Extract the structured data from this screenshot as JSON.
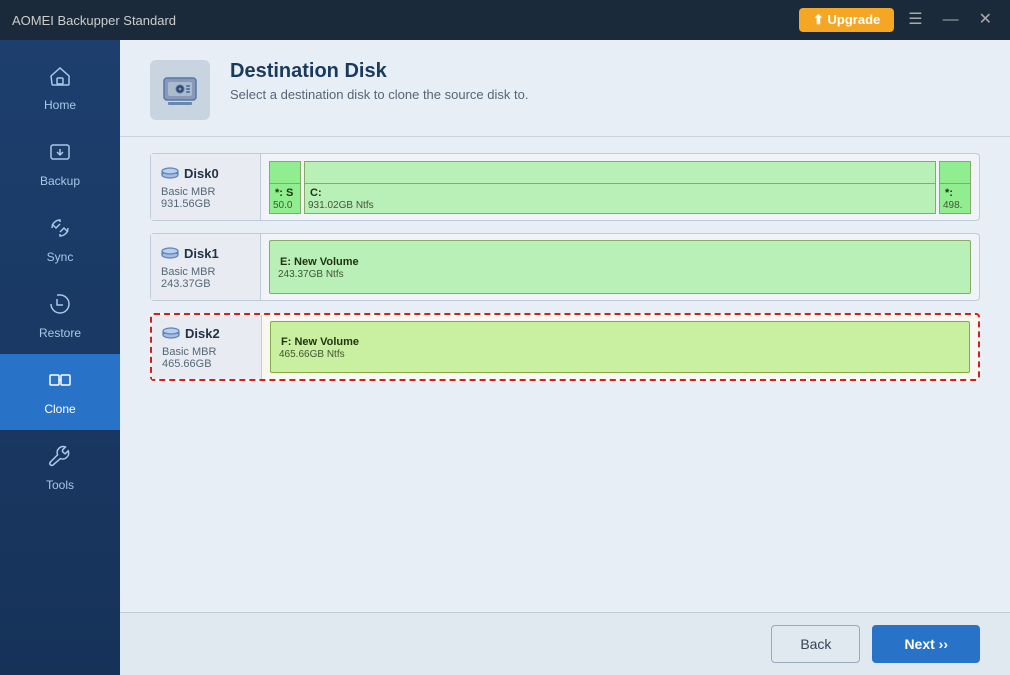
{
  "titlebar": {
    "title": "AOMEI Backupper Standard",
    "upgrade_label": "⬆ Upgrade",
    "menu_icon": "☰",
    "minimize_icon": "—",
    "close_icon": "✕"
  },
  "sidebar": {
    "items": [
      {
        "id": "home",
        "label": "Home",
        "icon": "🏠",
        "active": false
      },
      {
        "id": "backup",
        "label": "Backup",
        "icon": "📤",
        "active": false
      },
      {
        "id": "sync",
        "label": "Sync",
        "icon": "🔄",
        "active": false
      },
      {
        "id": "restore",
        "label": "Restore",
        "icon": "↩",
        "active": false
      },
      {
        "id": "clone",
        "label": "Clone",
        "icon": "🖧",
        "active": true
      },
      {
        "id": "tools",
        "label": "Tools",
        "icon": "🔧",
        "active": false
      }
    ]
  },
  "header": {
    "icon": "🖥",
    "title": "Destination Disk",
    "subtitle": "Select a destination disk to clone the source disk to."
  },
  "disks": [
    {
      "id": "disk0",
      "name": "Disk0",
      "type": "Basic MBR",
      "size": "931.56GB",
      "selected": false,
      "partitions": [
        {
          "label": "*: S",
          "sublabel": "50.0",
          "type": "system"
        },
        {
          "label": "C:",
          "sublabel": "931.02GB Ntfs",
          "type": "main"
        },
        {
          "label": "*:",
          "sublabel": "498.",
          "type": "small"
        }
      ]
    },
    {
      "id": "disk1",
      "name": "Disk1",
      "type": "Basic MBR",
      "size": "243.37GB",
      "selected": false,
      "partitions": [
        {
          "label": "E: New Volume",
          "sublabel": "243.37GB Ntfs",
          "type": "full"
        }
      ]
    },
    {
      "id": "disk2",
      "name": "Disk2",
      "type": "Basic MBR",
      "size": "465.66GB",
      "selected": true,
      "partitions": [
        {
          "label": "F: New Volume",
          "sublabel": "465.66GB Ntfs",
          "type": "full"
        }
      ]
    }
  ],
  "footer": {
    "back_label": "Back",
    "next_label": "Next ››"
  }
}
